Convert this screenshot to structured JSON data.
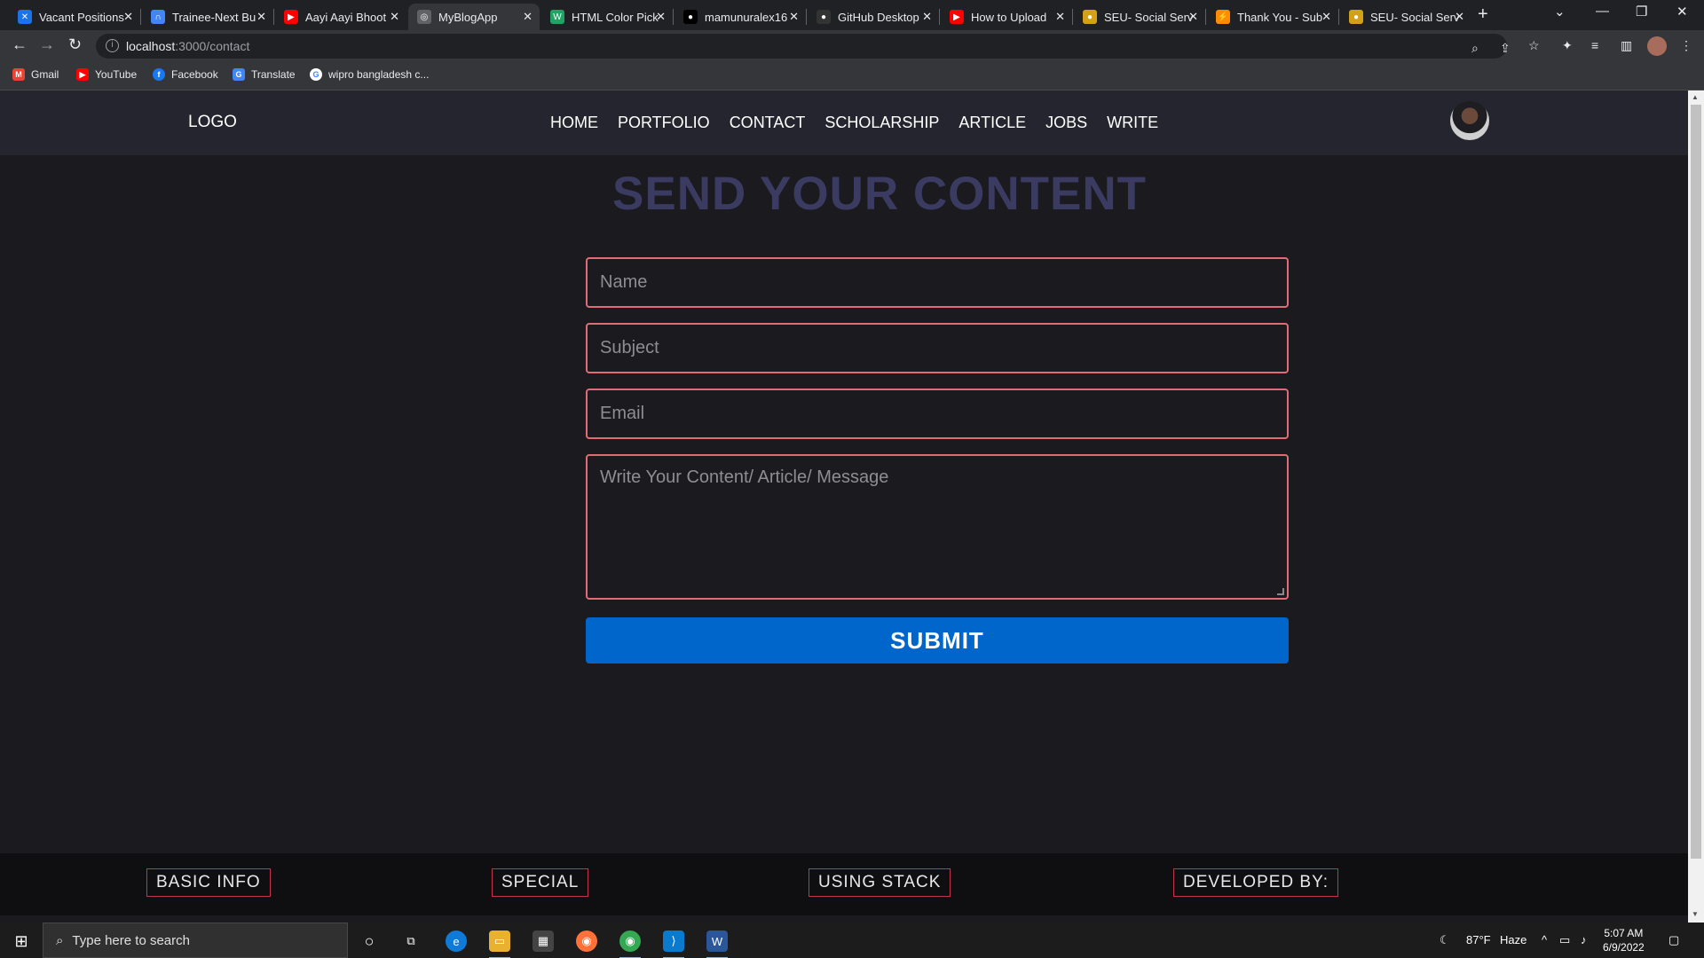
{
  "browser": {
    "tabs": [
      {
        "title": "Vacant Positions",
        "color": "#1a73e8",
        "glyph": "✕"
      },
      {
        "title": "Trainee-Next Bu",
        "color": "#4285f4",
        "glyph": "∩"
      },
      {
        "title": "Aayi Aayi Bhoot",
        "color": "#ff0000",
        "glyph": "▶"
      },
      {
        "title": "MyBlogApp",
        "color": "#5f6368",
        "glyph": "◎"
      },
      {
        "title": "HTML Color Pick",
        "color": "#21a366",
        "glyph": "W"
      },
      {
        "title": "mamunuralex16",
        "color": "#000000",
        "glyph": "●"
      },
      {
        "title": "GitHub Desktop",
        "color": "#333333",
        "glyph": "●"
      },
      {
        "title": "How to Upload",
        "color": "#ff0000",
        "glyph": "▶"
      },
      {
        "title": "SEU- Social Serv",
        "color": "#d4a017",
        "glyph": "●"
      },
      {
        "title": "Thank You - Sub",
        "color": "#ff8c00",
        "glyph": "⚡"
      },
      {
        "title": "SEU- Social Serv",
        "color": "#d4a017",
        "glyph": "●"
      }
    ],
    "url_host": "localhost",
    "url_path": ":3000/contact",
    "new_tab": "+",
    "bookmarks": [
      {
        "label": "Gmail",
        "color": "#ea4335",
        "glyph": "M"
      },
      {
        "label": "YouTube",
        "color": "#ff0000",
        "glyph": "▶"
      },
      {
        "label": "Facebook",
        "color": "#1877f2",
        "glyph": "f"
      },
      {
        "label": "Translate",
        "color": "#4285f4",
        "glyph": "G"
      },
      {
        "label": "wipro bangladesh c...",
        "color": "#202124",
        "glyph": "G"
      }
    ]
  },
  "site": {
    "logo": "LOGO",
    "nav": [
      "HOME",
      "PORTFOLIO",
      "CONTACT",
      "SCHOLARSHIP",
      "ARTICLE",
      "JOBS",
      "WRITE"
    ],
    "heading": "SEND YOUR CONTENT",
    "form": {
      "name_placeholder": "Name",
      "subject_placeholder": "Subject",
      "email_placeholder": "Email",
      "message_placeholder": "Write Your Content/ Article/ Message",
      "submit_label": "SUBMIT"
    },
    "footer": [
      "BASIC INFO",
      "SPECIAL",
      "USING STACK",
      "DEVELOPED BY:"
    ]
  },
  "taskbar": {
    "search_placeholder": "Type here to search",
    "weather_temp": "87°F",
    "weather_desc": "Haze",
    "time": "5:07 AM",
    "date": "6/9/2022"
  }
}
